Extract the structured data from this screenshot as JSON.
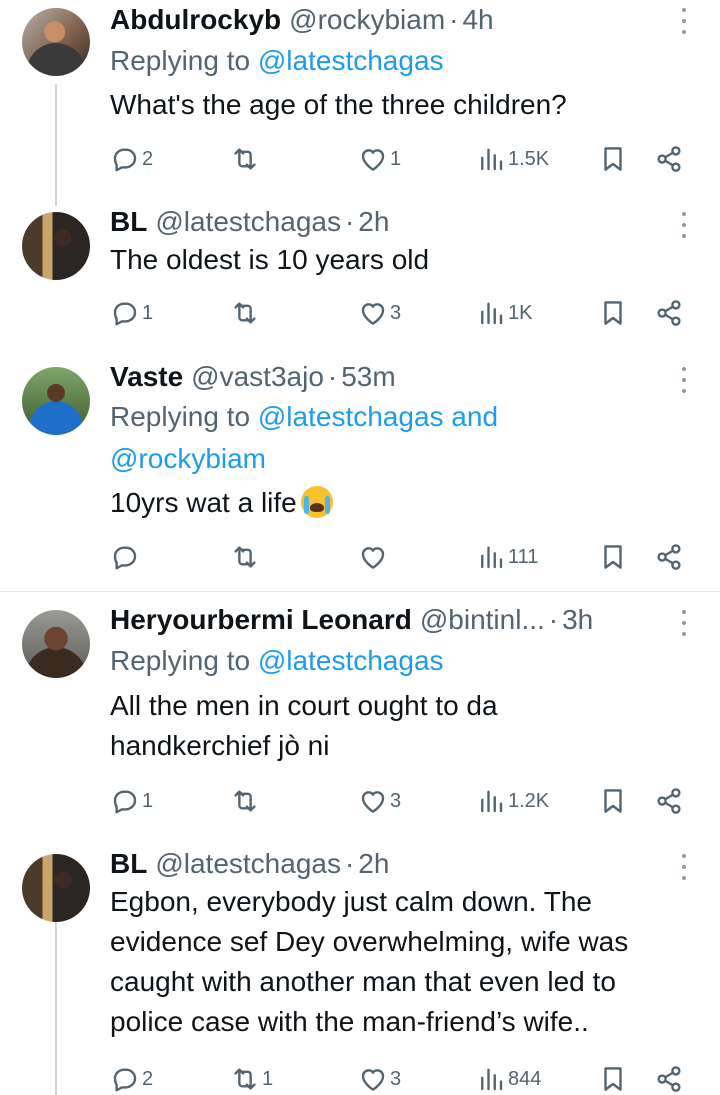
{
  "tweets": [
    {
      "name": "Abdulrockyb",
      "handle": "@rockybiam",
      "time": "4h",
      "reply_prefix": "Replying to",
      "reply_to": "@latestchagas",
      "reply_to_2": "",
      "text_lines": [
        "What's the age of the three children?"
      ],
      "replies": "2",
      "retweets": "",
      "likes": "1",
      "views": "1.5K"
    },
    {
      "name": "BL",
      "handle": "@latestchagas",
      "time": "2h",
      "text_lines": [
        "The oldest is 10 years old"
      ],
      "replies": "1",
      "retweets": "",
      "likes": "3",
      "views": "1K"
    },
    {
      "name": "Vaste",
      "handle": "@vast3ajo",
      "time": "53m",
      "reply_prefix": "Replying to",
      "reply_to": "@latestchagas",
      "reply_and": "and",
      "reply_to_2": "@rockybiam",
      "text_lines": [
        "10yrs wat a life"
      ],
      "emoji": "loudly-crying-face",
      "replies": "",
      "retweets": "",
      "likes": "",
      "views": "111"
    },
    {
      "name": "Heryourbermi Leonard",
      "handle": "@bintinl...",
      "time": "3h",
      "reply_prefix": "Replying to",
      "reply_to": "@latestchagas",
      "text_lines": [
        "All the men in court ought to da",
        "handkerchief jò ni"
      ],
      "replies": "1",
      "retweets": "",
      "likes": "3",
      "views": "1.2K"
    },
    {
      "name": "BL",
      "handle": "@latestchagas",
      "time": "2h",
      "text_lines": [
        "Egbon, everybody just calm down. The",
        "evidence sef Dey overwhelming, wife was",
        "caught with another man that even led to",
        "police case with the man-friend’s wife.."
      ],
      "replies": "2",
      "retweets": "1",
      "likes": "3",
      "views": "844"
    }
  ],
  "separator": "·",
  "colors": {
    "link": "#1d9bf0",
    "secondary": "#536471",
    "text": "#0f1419",
    "thread": "#cfd9de"
  },
  "icons": [
    "reply-icon",
    "retweet-icon",
    "like-icon",
    "views-icon",
    "bookmark-icon",
    "share-icon",
    "more-icon"
  ]
}
